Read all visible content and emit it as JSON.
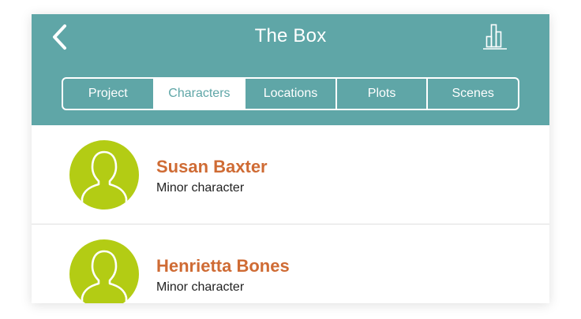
{
  "header": {
    "title": "The Box",
    "background_color": "#5fa6a7",
    "back_icon": "chevron-left-icon",
    "stats_icon": "bar-chart-icon"
  },
  "tabs": [
    {
      "label": "Project",
      "active": false
    },
    {
      "label": "Characters",
      "active": true
    },
    {
      "label": "Locations",
      "active": false
    },
    {
      "label": "Plots",
      "active": false
    },
    {
      "label": "Scenes",
      "active": false
    }
  ],
  "characters": [
    {
      "name": "Susan Baxter",
      "role": "Minor character",
      "avatar_icon": "person-silhouette-icon"
    },
    {
      "name": "Henrietta Bones",
      "role": "Minor character",
      "avatar_icon": "person-silhouette-icon"
    }
  ],
  "colors": {
    "name_text": "#cf6b34",
    "avatar_bg": "#b3cc14"
  }
}
